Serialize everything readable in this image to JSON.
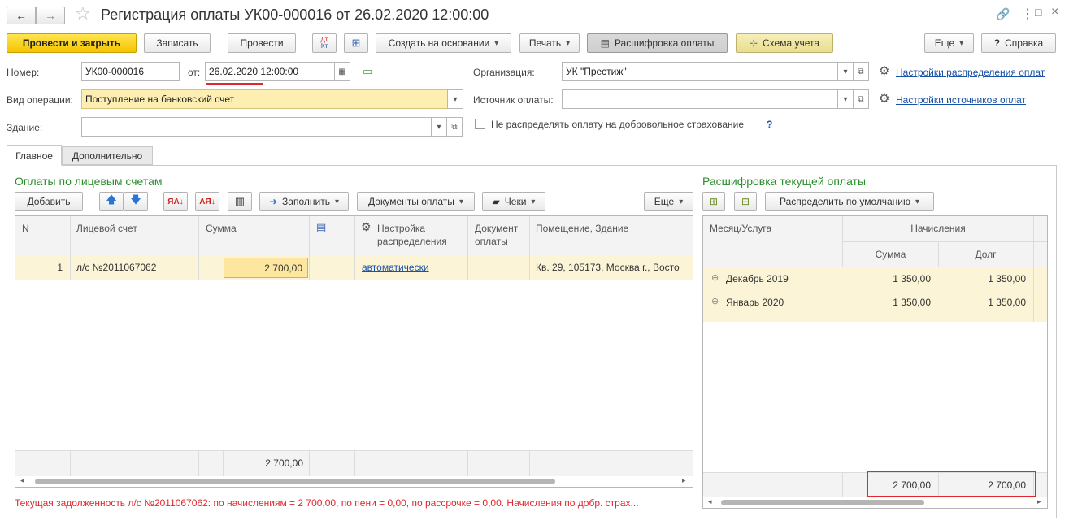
{
  "window": {
    "title": "Регистрация оплаты УК00-000016 от 26.02.2020 12:00:00"
  },
  "toolbar": {
    "post_close": "Провести и закрыть",
    "save": "Записать",
    "post": "Провести",
    "dt_kt_top": "Дт",
    "dt_kt_bottom": "Кт",
    "create_based": "Создать на основании",
    "print": "Печать",
    "payment_breakdown": "Расшифровка оплаты",
    "accounting_scheme": "Схема учета",
    "more": "Еще",
    "help": "Справка"
  },
  "form": {
    "number_label": "Номер:",
    "number_value": "УК00-000016",
    "date_label": "от:",
    "date_value": "26.02.2020 12:00:00",
    "organization_label": "Организация:",
    "organization_value": "УК \"Престиж\"",
    "operation_label": "Вид операции:",
    "operation_value": "Поступление на банковский счет",
    "payment_source_label": "Источник оплаты:",
    "payment_source_value": "",
    "building_label": "Здание:",
    "building_value": "",
    "no_distribute_label": "Не распределять оплату на добровольное страхование",
    "help_mark": "?",
    "distribution_settings_link": "Настройки распределения оплат",
    "source_settings_link": "Настройки источников оплат"
  },
  "tabs": [
    {
      "label": "Главное",
      "active": true
    },
    {
      "label": "Дополнительно",
      "active": false
    }
  ],
  "left_panel": {
    "title": "Оплаты по лицевым счетам",
    "add": "Добавить",
    "fill": "Заполнить",
    "payment_docs": "Документы оплаты",
    "receipts": "Чеки",
    "more": "Еще",
    "columns": {
      "n": "N",
      "account": "Лицевой счет",
      "sum": "Сумма",
      "setting_line1": "Настройка",
      "setting_line2": "распределения",
      "doc_line1": "Документ",
      "doc_line2": "оплаты",
      "premises": "Помещение, Здание"
    },
    "rows": [
      {
        "n": "1",
        "account": "л/с №2011067062",
        "sum": "2 700,00",
        "setting": "автоматически",
        "doc": "",
        "premises": "Кв. 29, 105173, Москва г., Восто"
      }
    ],
    "total_sum": "2 700,00",
    "status": "Текущая задолженность л/с №2011067062: по начислениям = 2 700,00, по пени = 0,00, по рассрочке = 0,00. Начисления по добр. страх..."
  },
  "right_panel": {
    "title": "Расшифровка текущей оплаты",
    "distribute_default": "Распределить по умолчанию",
    "columns": {
      "month_service": "Месяц/Услуга",
      "charges": "Начисления",
      "sum": "Сумма",
      "debt": "Долг"
    },
    "rows": [
      {
        "expand": "⊕",
        "label": "Декабрь 2019",
        "sum": "1 350,00",
        "debt": "1 350,00"
      },
      {
        "expand": "⊕",
        "label": "Январь 2020",
        "sum": "1 350,00",
        "debt": "1 350,00"
      }
    ],
    "total_sum": "2 700,00",
    "total_debt": "2 700,00"
  },
  "colors": {
    "primary_button": "#f5c400",
    "selected_row": "#fbf4d7",
    "status_text": "#e0282e",
    "section_title": "#2c8d2c",
    "highlight_border": "#e0282e"
  }
}
